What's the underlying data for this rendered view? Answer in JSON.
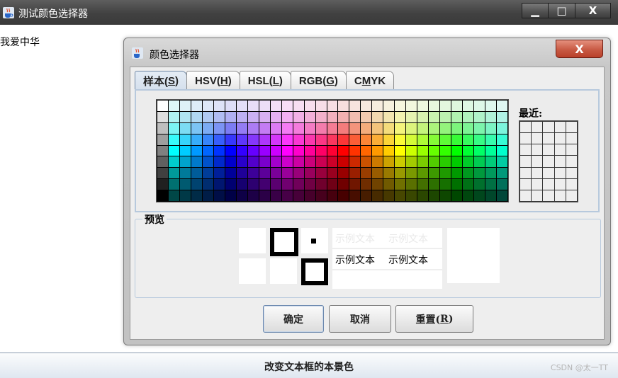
{
  "window": {
    "title": "测试颜色选择器",
    "icon": "java-cup-icon"
  },
  "text_area": {
    "content": "我爱中华"
  },
  "dialog": {
    "title": "颜色选择器",
    "tabs": [
      {
        "label": "样本(",
        "mnemonic": "S",
        "suffix": ")"
      },
      {
        "label": "HSV(",
        "mnemonic": "H",
        "suffix": ")"
      },
      {
        "label": "HSL(",
        "mnemonic": "L",
        "suffix": ")"
      },
      {
        "label": "RGB(",
        "mnemonic": "G",
        "suffix": ")"
      },
      {
        "label": "C",
        "mnemonic": "M",
        "suffix": "YK"
      }
    ],
    "recent_label": "最近:",
    "preview_label": "预览",
    "sample_text": "示例文本",
    "buttons": {
      "ok": "确定",
      "cancel": "取消",
      "reset_label": "重置(",
      "reset_mnemonic": "R",
      "reset_suffix": ")"
    }
  },
  "bottom_button": {
    "label": "改变文本框的本景色"
  },
  "watermark": "CSDN @太一TT"
}
